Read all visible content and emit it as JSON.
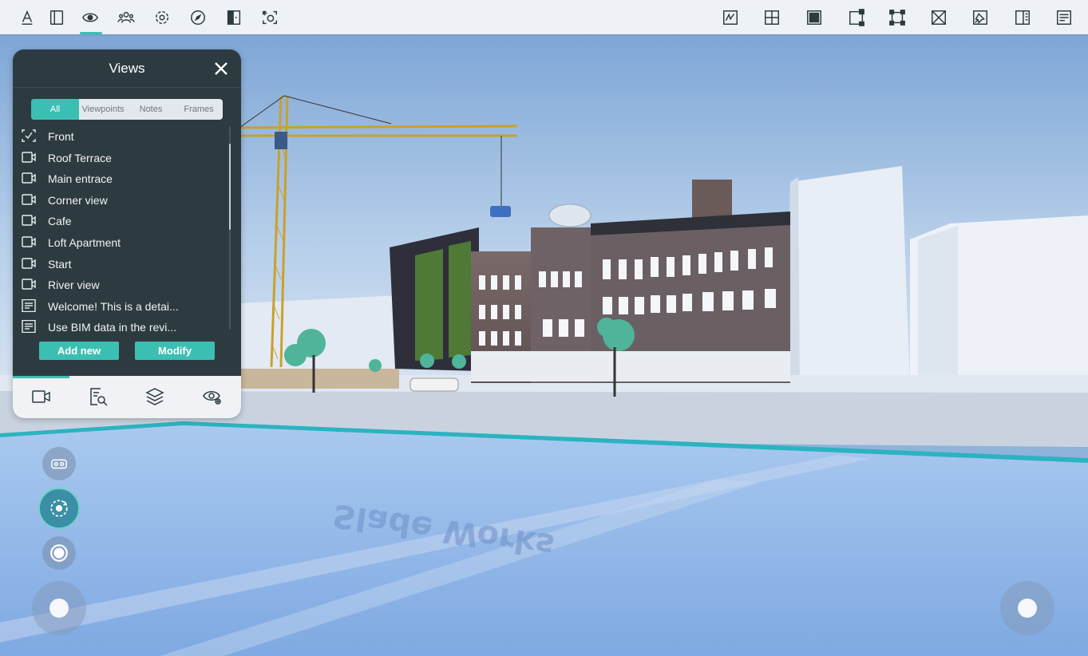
{
  "toolbar": {
    "left_icons": [
      "measure-icon",
      "panels-icon",
      "eye-icon",
      "people-icon",
      "settings-icon",
      "compass-icon",
      "door-icon",
      "camera-focus-icon"
    ],
    "right_icons": [
      "sketch-icon",
      "grid-view-icon",
      "solid-view-icon",
      "crop-view-icon",
      "bounding-box-icon",
      "x-section-icon",
      "pin-icon",
      "split-panel-icon",
      "properties-icon"
    ],
    "active": "eye-icon"
  },
  "views_panel": {
    "title": "Views",
    "tabs": [
      "All",
      "Viewpoints",
      "Notes",
      "Frames"
    ],
    "active_tab": "All",
    "items": [
      {
        "label": "Front",
        "icon": "viewpoint-active-icon"
      },
      {
        "label": "Roof Terrace",
        "icon": "camera-icon"
      },
      {
        "label": "Main entrace",
        "icon": "camera-icon"
      },
      {
        "label": "Corner view",
        "icon": "camera-icon"
      },
      {
        "label": "Cafe",
        "icon": "camera-icon"
      },
      {
        "label": "Loft Apartment",
        "icon": "camera-icon"
      },
      {
        "label": "Start",
        "icon": "camera-icon"
      },
      {
        "label": "River view",
        "icon": "camera-icon"
      },
      {
        "label": "Welcome! This is a detai...",
        "icon": "note-icon"
      },
      {
        "label": "Use BIM data in the revi...",
        "icon": "note-icon"
      }
    ],
    "add_button": "Add new",
    "modify_button": "Modify",
    "bottom_nav": [
      "video-camera-icon",
      "document-search-icon",
      "layers-icon",
      "eye-settings-icon"
    ]
  },
  "colors": {
    "accent": "#3cbfb3",
    "panel_bg": "#2d3b40",
    "toolbar_bg": "#eef1f6"
  }
}
